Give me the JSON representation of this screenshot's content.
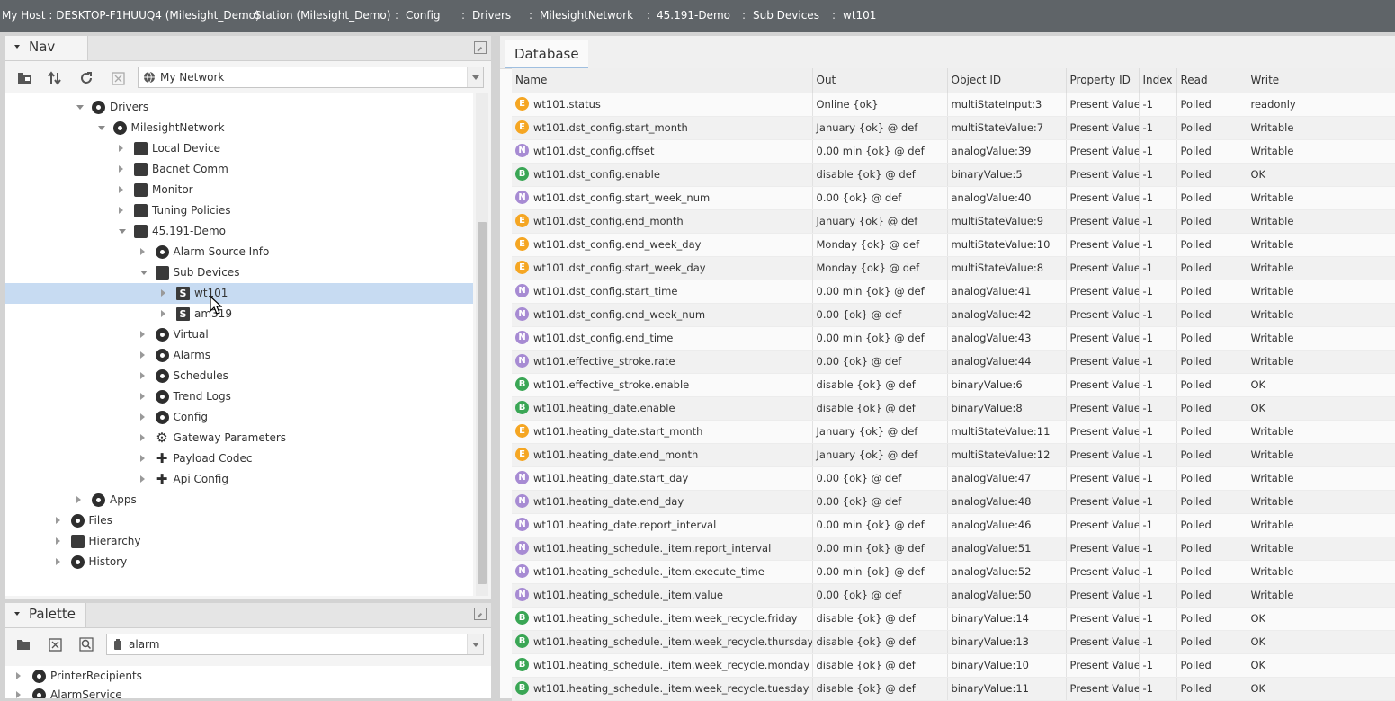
{
  "breadcrumb": [
    {
      "label": "My Host : DESKTOP-F1HUUQ4 (Milesight_Demo)"
    },
    {
      "label": "Station (Milesight_Demo)"
    },
    {
      "label": "Config"
    },
    {
      "label": "Drivers"
    },
    {
      "label": "MilesightNetwork"
    },
    {
      "label": "45.191-Demo"
    },
    {
      "label": "Sub Devices"
    },
    {
      "label": "wt101"
    }
  ],
  "nav": {
    "title": "Nav",
    "network_selector": "My Network",
    "tree": [
      {
        "label": "Services",
        "depth": 1,
        "state": "closed",
        "icon": "services-icon"
      },
      {
        "label": "Drivers",
        "depth": 1,
        "state": "open",
        "icon": "drivers-icon"
      },
      {
        "label": "MilesightNetwork",
        "depth": 2,
        "state": "open",
        "icon": "network-icon"
      },
      {
        "label": "Local Device",
        "depth": 3,
        "state": "closed",
        "icon": "local-device-icon"
      },
      {
        "label": "Bacnet Comm",
        "depth": 3,
        "state": "closed",
        "icon": "bacnet-comm-icon"
      },
      {
        "label": "Monitor",
        "depth": 3,
        "state": "closed",
        "icon": "monitor-icon"
      },
      {
        "label": "Tuning Policies",
        "depth": 3,
        "state": "closed",
        "icon": "tuning-policies-icon"
      },
      {
        "label": "45.191-Demo",
        "depth": 3,
        "state": "open",
        "icon": "device-icon"
      },
      {
        "label": "Alarm Source Info",
        "depth": 4,
        "state": "closed",
        "icon": "alarm-source-icon"
      },
      {
        "label": "Sub Devices",
        "depth": 4,
        "state": "open",
        "icon": "sub-devices-icon"
      },
      {
        "label": "wt101",
        "depth": 5,
        "state": "closed",
        "icon": "s-device-icon",
        "selected": true
      },
      {
        "label": "am319",
        "depth": 5,
        "state": "closed",
        "icon": "s-device-icon"
      },
      {
        "label": "Virtual",
        "depth": 4,
        "state": "closed",
        "icon": "virtual-icon"
      },
      {
        "label": "Alarms",
        "depth": 4,
        "state": "closed",
        "icon": "alarms-icon"
      },
      {
        "label": "Schedules",
        "depth": 4,
        "state": "closed",
        "icon": "schedules-icon"
      },
      {
        "label": "Trend Logs",
        "depth": 4,
        "state": "closed",
        "icon": "trend-logs-icon"
      },
      {
        "label": "Config",
        "depth": 4,
        "state": "closed",
        "icon": "config-icon"
      },
      {
        "label": "Gateway Parameters",
        "depth": 4,
        "state": "closed",
        "icon": "gear-icon"
      },
      {
        "label": "Payload Codec",
        "depth": 4,
        "state": "closed",
        "icon": "puzzle-icon"
      },
      {
        "label": "Api Config",
        "depth": 4,
        "state": "closed",
        "icon": "puzzle-icon"
      },
      {
        "label": "Apps",
        "depth": 1,
        "state": "closed",
        "icon": "apps-icon"
      },
      {
        "label": "Files",
        "depth": 0,
        "state": "closed",
        "icon": "files-icon"
      },
      {
        "label": "Hierarchy",
        "depth": 0,
        "state": "closed",
        "icon": "hierarchy-icon"
      },
      {
        "label": "History",
        "depth": 0,
        "state": "closed",
        "icon": "history-icon"
      }
    ]
  },
  "palette": {
    "title": "Palette",
    "search_value": "alarm",
    "items": [
      {
        "label": "PrinterRecipients"
      },
      {
        "label": "AlarmService"
      }
    ]
  },
  "database": {
    "tab_label": "Database",
    "columns": [
      "Name",
      "Out",
      "Object ID",
      "Property ID",
      "Index",
      "Read",
      "Write"
    ],
    "rows": [
      {
        "type": "E",
        "name": "wt101.status",
        "out": "Online {ok}",
        "object_id": "multiStateInput:3",
        "property_id": "Present Value",
        "index": "-1",
        "read": "Polled",
        "write": "readonly"
      },
      {
        "type": "E",
        "name": "wt101.dst_config.start_month",
        "out": "January {ok} @ def",
        "object_id": "multiStateValue:7",
        "property_id": "Present Value",
        "index": "-1",
        "read": "Polled",
        "write": "Writable"
      },
      {
        "type": "N",
        "name": "wt101.dst_config.offset",
        "out": "0.00 min {ok} @ def",
        "object_id": "analogValue:39",
        "property_id": "Present Value",
        "index": "-1",
        "read": "Polled",
        "write": "Writable"
      },
      {
        "type": "B",
        "name": "wt101.dst_config.enable",
        "out": "disable {ok} @ def",
        "object_id": "binaryValue:5",
        "property_id": "Present Value",
        "index": "-1",
        "read": "Polled",
        "write": "OK"
      },
      {
        "type": "N",
        "name": "wt101.dst_config.start_week_num",
        "out": "0.00 {ok} @ def",
        "object_id": "analogValue:40",
        "property_id": "Present Value",
        "index": "-1",
        "read": "Polled",
        "write": "Writable"
      },
      {
        "type": "E",
        "name": "wt101.dst_config.end_month",
        "out": "January {ok} @ def",
        "object_id": "multiStateValue:9",
        "property_id": "Present Value",
        "index": "-1",
        "read": "Polled",
        "write": "Writable"
      },
      {
        "type": "E",
        "name": "wt101.dst_config.end_week_day",
        "out": "Monday {ok} @ def",
        "object_id": "multiStateValue:10",
        "property_id": "Present Value",
        "index": "-1",
        "read": "Polled",
        "write": "Writable"
      },
      {
        "type": "E",
        "name": "wt101.dst_config.start_week_day",
        "out": "Monday {ok} @ def",
        "object_id": "multiStateValue:8",
        "property_id": "Present Value",
        "index": "-1",
        "read": "Polled",
        "write": "Writable"
      },
      {
        "type": "N",
        "name": "wt101.dst_config.start_time",
        "out": "0.00 min {ok} @ def",
        "object_id": "analogValue:41",
        "property_id": "Present Value",
        "index": "-1",
        "read": "Polled",
        "write": "Writable"
      },
      {
        "type": "N",
        "name": "wt101.dst_config.end_week_num",
        "out": "0.00 {ok} @ def",
        "object_id": "analogValue:42",
        "property_id": "Present Value",
        "index": "-1",
        "read": "Polled",
        "write": "Writable"
      },
      {
        "type": "N",
        "name": "wt101.dst_config.end_time",
        "out": "0.00 min {ok} @ def",
        "object_id": "analogValue:43",
        "property_id": "Present Value",
        "index": "-1",
        "read": "Polled",
        "write": "Writable"
      },
      {
        "type": "N",
        "name": "wt101.effective_stroke.rate",
        "out": "0.00 {ok} @ def",
        "object_id": "analogValue:44",
        "property_id": "Present Value",
        "index": "-1",
        "read": "Polled",
        "write": "Writable"
      },
      {
        "type": "B",
        "name": "wt101.effective_stroke.enable",
        "out": "disable {ok} @ def",
        "object_id": "binaryValue:6",
        "property_id": "Present Value",
        "index": "-1",
        "read": "Polled",
        "write": "OK"
      },
      {
        "type": "B",
        "name": "wt101.heating_date.enable",
        "out": "disable {ok} @ def",
        "object_id": "binaryValue:8",
        "property_id": "Present Value",
        "index": "-1",
        "read": "Polled",
        "write": "OK"
      },
      {
        "type": "E",
        "name": "wt101.heating_date.start_month",
        "out": "January {ok} @ def",
        "object_id": "multiStateValue:11",
        "property_id": "Present Value",
        "index": "-1",
        "read": "Polled",
        "write": "Writable"
      },
      {
        "type": "E",
        "name": "wt101.heating_date.end_month",
        "out": "January {ok} @ def",
        "object_id": "multiStateValue:12",
        "property_id": "Present Value",
        "index": "-1",
        "read": "Polled",
        "write": "Writable"
      },
      {
        "type": "N",
        "name": "wt101.heating_date.start_day",
        "out": "0.00 {ok} @ def",
        "object_id": "analogValue:47",
        "property_id": "Present Value",
        "index": "-1",
        "read": "Polled",
        "write": "Writable"
      },
      {
        "type": "N",
        "name": "wt101.heating_date.end_day",
        "out": "0.00 {ok} @ def",
        "object_id": "analogValue:48",
        "property_id": "Present Value",
        "index": "-1",
        "read": "Polled",
        "write": "Writable"
      },
      {
        "type": "N",
        "name": "wt101.heating_date.report_interval",
        "out": "0.00 min {ok} @ def",
        "object_id": "analogValue:46",
        "property_id": "Present Value",
        "index": "-1",
        "read": "Polled",
        "write": "Writable"
      },
      {
        "type": "N",
        "name": "wt101.heating_schedule._item.report_interval",
        "out": "0.00 min {ok} @ def",
        "object_id": "analogValue:51",
        "property_id": "Present Value",
        "index": "-1",
        "read": "Polled",
        "write": "Writable"
      },
      {
        "type": "N",
        "name": "wt101.heating_schedule._item.execute_time",
        "out": "0.00 min {ok} @ def",
        "object_id": "analogValue:52",
        "property_id": "Present Value",
        "index": "-1",
        "read": "Polled",
        "write": "Writable"
      },
      {
        "type": "N",
        "name": "wt101.heating_schedule._item.value",
        "out": "0.00 {ok} @ def",
        "object_id": "analogValue:50",
        "property_id": "Present Value",
        "index": "-1",
        "read": "Polled",
        "write": "Writable"
      },
      {
        "type": "B",
        "name": "wt101.heating_schedule._item.week_recycle.friday",
        "out": "disable {ok} @ def",
        "object_id": "binaryValue:14",
        "property_id": "Present Value",
        "index": "-1",
        "read": "Polled",
        "write": "OK"
      },
      {
        "type": "B",
        "name": "wt101.heating_schedule._item.week_recycle.thursday",
        "out": "disable {ok} @ def",
        "object_id": "binaryValue:13",
        "property_id": "Present Value",
        "index": "-1",
        "read": "Polled",
        "write": "OK"
      },
      {
        "type": "B",
        "name": "wt101.heating_schedule._item.week_recycle.monday",
        "out": "disable {ok} @ def",
        "object_id": "binaryValue:10",
        "property_id": "Present Value",
        "index": "-1",
        "read": "Polled",
        "write": "OK"
      },
      {
        "type": "B",
        "name": "wt101.heating_schedule._item.week_recycle.tuesday",
        "out": "disable {ok} @ def",
        "object_id": "binaryValue:11",
        "property_id": "Present Value",
        "index": "-1",
        "read": "Polled",
        "write": "OK"
      }
    ]
  },
  "colors": {
    "topbar": "#5f6468",
    "selected_row": "#c7dbf2",
    "badge_enum": "#f5a623",
    "badge_numeric": "#a78bd3",
    "badge_boolean": "#3aa655"
  }
}
